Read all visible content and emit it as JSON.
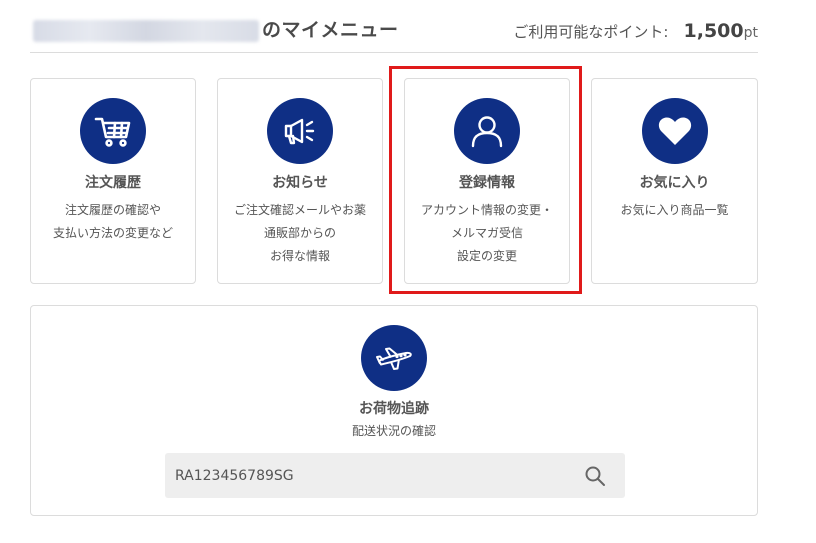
{
  "header": {
    "title": "のマイメニュー",
    "points_label": "ご利用可能なポイント:",
    "points_value": "1,500",
    "points_unit": "pt"
  },
  "menu": [
    {
      "title": "注文履歴",
      "desc": [
        "注文履歴の確認や",
        "支払い方法の変更など"
      ],
      "icon": "cart-icon"
    },
    {
      "title": "お知らせ",
      "desc": [
        "ご注文確認メールやお薬",
        "通販部からの",
        "お得な情報"
      ],
      "icon": "megaphone-icon"
    },
    {
      "title": "登録情報",
      "desc": [
        "アカウント情報の変更・",
        "メルマガ受信",
        "設定の変更"
      ],
      "icon": "user-icon"
    },
    {
      "title": "お気に入り",
      "desc": [
        "お気に入り商品一覧"
      ],
      "icon": "heart-icon"
    }
  ],
  "tracking": {
    "title": "お荷物追跡",
    "desc": "配送状況の確認",
    "placeholder": "RA123456789SG",
    "icon": "airplane-icon",
    "search_icon": "search-icon"
  },
  "colors": {
    "icon_bg": "#0f2f85",
    "highlight": "#e01a1a",
    "border": "#dcdcdc",
    "input_bg": "#eeeeee"
  }
}
